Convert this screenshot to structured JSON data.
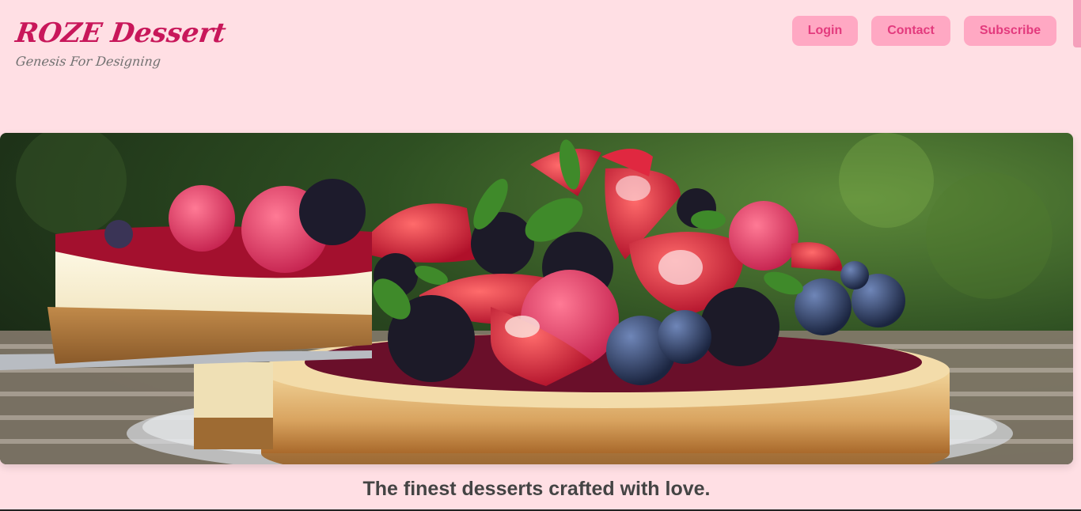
{
  "brand": {
    "title": "ROZE Dessert",
    "tagline": "Genesis For Designing"
  },
  "nav": {
    "login": "Login",
    "contact": "Contact",
    "subscribe": "Subscribe"
  },
  "hero": {
    "tagline": "The finest desserts crafted with love."
  },
  "colors": {
    "background": "#ffdfe4",
    "brand": "#c8175a",
    "button_bg": "#ffa8c3",
    "button_text": "#e33a7d",
    "tagline_text": "#444444"
  }
}
